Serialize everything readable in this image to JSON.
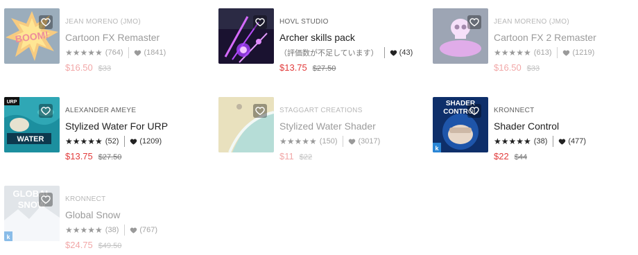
{
  "colors": {
    "sale_price": "#e23b3b",
    "text": "#212121",
    "muted": "#606060"
  },
  "products": [
    {
      "publisher": "JEAN MORENO (JMO)",
      "title": "Cartoon FX Remaster",
      "rating_count": "(764)",
      "favorites": "(1841)",
      "price": "$16.50",
      "old_price": "$33",
      "rating_stars": 5,
      "owned_dim": true,
      "thumb_icon": "boom-explosion-thumbnail"
    },
    {
      "publisher": "HOVL STUDIO",
      "title": "Archer skills pack",
      "rating_note": "（評価数が不足しています）",
      "favorites": "(43)",
      "price": "$13.75",
      "old_price": "$27.50",
      "owned_dim": false,
      "thumb_icon": "purple-magic-arrows-thumbnail"
    },
    {
      "publisher": "JEAN MORENO (JMO)",
      "title": "Cartoon FX 2 Remaster",
      "rating_count": "(613)",
      "favorites": "(1219)",
      "price": "$16.50",
      "old_price": "$33",
      "rating_stars": 5,
      "owned_dim": true,
      "thumb_icon": "skull-smoke-thumbnail"
    },
    {
      "publisher": "ALEXANDER AMEYE",
      "title": "Stylized Water For URP",
      "rating_count": "(52)",
      "favorites": "(1209)",
      "price": "$13.75",
      "old_price": "$27.50",
      "rating_stars": 5,
      "owned_dim": false,
      "thumb_icon": "urp-water-thumbnail",
      "badge": "URP",
      "thumb_text": "WATER"
    },
    {
      "publisher": "STAGGART CREATIONS",
      "title": "Stylized Water Shader",
      "rating_count": "(150)",
      "favorites": "(3017)",
      "price": "$11",
      "old_price": "$22",
      "rating_stars": 5,
      "owned_dim": true,
      "thumb_icon": "beach-water-thumbnail"
    },
    {
      "publisher": "KRONNECT",
      "title": "Shader Control",
      "rating_count": "(38)",
      "favorites": "(477)",
      "price": "$22",
      "old_price": "$44",
      "rating_stars": 5,
      "owned_dim": false,
      "thumb_icon": "shader-control-fist-thumbnail",
      "thumb_text": "SHADER CONTROL"
    },
    {
      "publisher": "KRONNECT",
      "title": "Global Snow",
      "rating_count": "(38)",
      "favorites": "(767)",
      "price": "$24.75",
      "old_price": "$49.50",
      "rating_stars": 5,
      "owned_dim": true,
      "thumb_icon": "global-snow-thumbnail",
      "thumb_text": "GLOBAL SNOW"
    }
  ]
}
